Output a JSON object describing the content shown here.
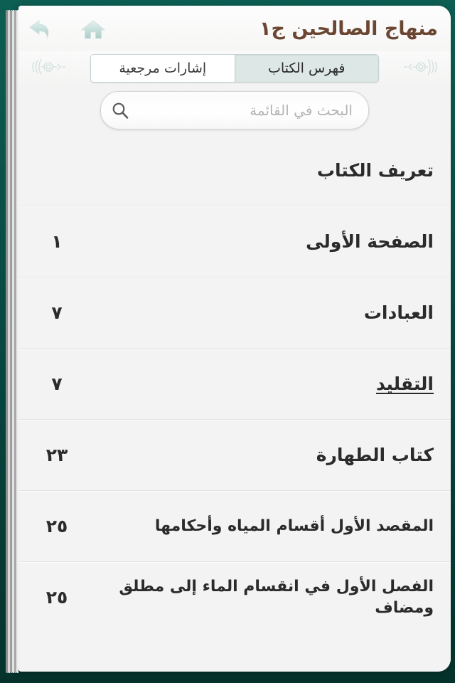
{
  "header": {
    "title": "منهاج الصالحين ج١",
    "back_icon": "back-arrow-icon",
    "home_icon": "home-icon",
    "title_color": "#6b4733"
  },
  "tabs": [
    {
      "label": "إشارات مرجعية",
      "active": false
    },
    {
      "label": "فهرس الكتاب",
      "active": true
    }
  ],
  "search": {
    "placeholder": "البحث في القائمة",
    "value": "",
    "icon": "search-icon"
  },
  "toc": {
    "rows": [
      {
        "title": "تعريف الكتاب",
        "page": "",
        "active": false,
        "small": false
      },
      {
        "title": "الصفحة الأولى",
        "page": "١",
        "active": false,
        "small": false
      },
      {
        "title": "العبادات",
        "page": "٧",
        "active": false,
        "small": false
      },
      {
        "title": "التقليد",
        "page": "٧",
        "active": true,
        "small": false
      },
      {
        "title": "كتاب الطهارة",
        "page": "٢٣",
        "active": false,
        "small": false
      },
      {
        "title": "المقصد الأول أقسام المياه وأحكامها",
        "page": "٢٥",
        "active": false,
        "small": true
      },
      {
        "title": "الفصل الأول في انقسام الماء إلى مطلق ومضاف",
        "page": "٢٥",
        "active": false,
        "small": true
      }
    ]
  },
  "theme": {
    "book_background": "#0a5248",
    "page_background": "#f3f3f3",
    "active_tab_fill": "#dce7e6",
    "icon_tint": "#bdd8d4"
  }
}
